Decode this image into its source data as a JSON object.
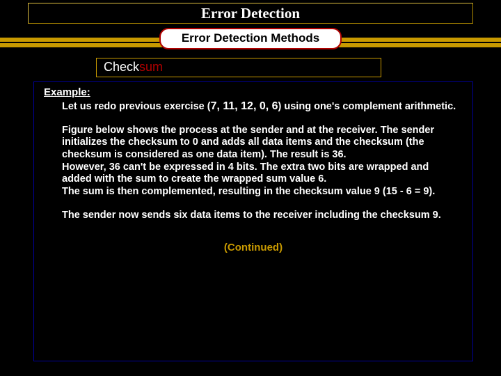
{
  "title": "Error Detection",
  "subtitle": "Error Detection Methods",
  "section": {
    "pre": "Check",
    "accent": "sum"
  },
  "example_label": "Example:",
  "p1_a": "Let us redo previous exercise (",
  "p1_nums": "7, 11, 12, 0, 6",
  "p1_b": ") using one's complement arithmetic.",
  "p2": "Figure below shows the process at the sender and at the receiver. The sender initializes the checksum to 0 and adds all data items and the checksum (the checksum is considered as one data item). The result is 36.\nHowever, 36 can't be expressed in 4 bits. The extra two bits are wrapped and added with the sum to create the wrapped sum value 6.\nThe sum is then complemented, resulting in the checksum value 9 (15 - 6 = 9).",
  "p3": "The sender now sends six data items to the receiver including the checksum 9.",
  "continued": "(Continued)",
  "colors": {
    "gold": "#c99a00",
    "red": "#b00000",
    "blue_border": "#000099"
  },
  "chart_data": {
    "type": "table",
    "note": "No chart; slide content only. Numeric sequence mentioned in text.",
    "values": [
      7,
      11,
      12,
      0,
      6
    ],
    "sum": 36,
    "wrapped_sum": 6,
    "checksum": 9
  }
}
